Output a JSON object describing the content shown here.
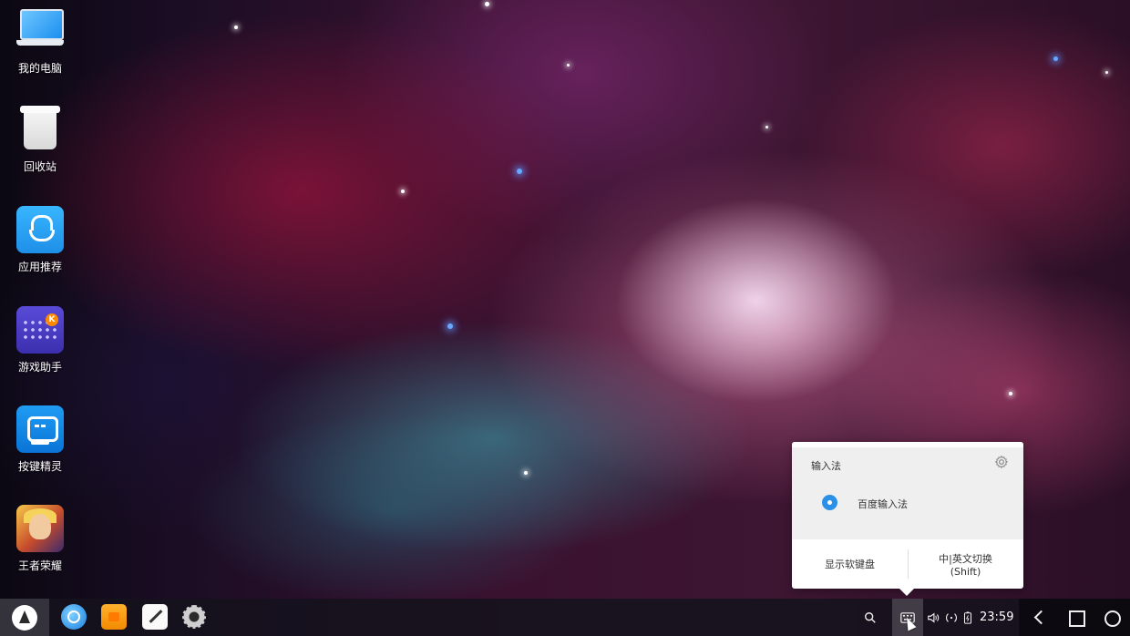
{
  "desktop": {
    "icons": [
      {
        "label": "我的电脑",
        "icon": "computer-icon"
      },
      {
        "label": "回收站",
        "icon": "recycle-bin-icon"
      },
      {
        "label": "应用推荐",
        "icon": "app-store-icon"
      },
      {
        "label": "游戏助手",
        "icon": "game-keyboard-icon"
      },
      {
        "label": "按键精灵",
        "icon": "key-sprite-icon"
      },
      {
        "label": "王者荣耀",
        "icon": "honor-of-kings-icon"
      }
    ]
  },
  "ime_popup": {
    "title": "输入法",
    "settings_icon": "gear-icon",
    "selected_input_method": "百度输入法",
    "show_keyboard_label": "显示软键盘",
    "toggle_label_line1": "中|英文切换",
    "toggle_label_line2": "(Shift)"
  },
  "taskbar": {
    "start_icon": "start-menu-icon",
    "apps": [
      "browser-icon",
      "file-manager-icon",
      "editor-icon",
      "settings-icon"
    ],
    "tray": {
      "search_icon": "search-icon",
      "keyboard_icon": "keyboard-icon",
      "volume_icon": "volume-icon",
      "network_icon": "network-icon",
      "battery_icon": "battery-icon",
      "clock": "23:59"
    },
    "nav": [
      "back-icon",
      "recent-apps-icon",
      "home-icon"
    ]
  },
  "colors": {
    "accent": "#2b91e8",
    "taskbar": "#14121c"
  }
}
